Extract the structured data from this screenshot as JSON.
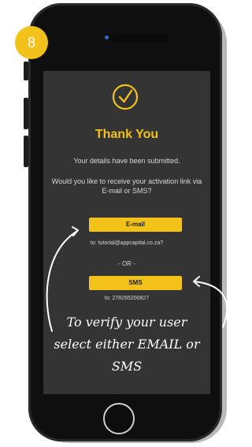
{
  "step": {
    "number": "8"
  },
  "screen": {
    "title": "Thank You",
    "submitted_text": "Your details have been submitted.",
    "question_text": "Would you like to receive your activation link via E-mail or SMS?",
    "email_button_label": "E-mail",
    "email_recipient": "to: tutorial@appcapital.co.za?",
    "or_separator": "- OR -",
    "sms_button_label": "SMS",
    "sms_recipient": "to: 278265200827"
  },
  "annotation": {
    "line1": "To verify your user",
    "line2": "select either EMAIL or",
    "line3": "SMS"
  },
  "colors": {
    "accent": "#f2c21a",
    "screen_bg": "#343434",
    "phone_body": "#0f0f0f"
  },
  "icons": {
    "success": "check-circle-icon",
    "camera": "camera-icon"
  }
}
